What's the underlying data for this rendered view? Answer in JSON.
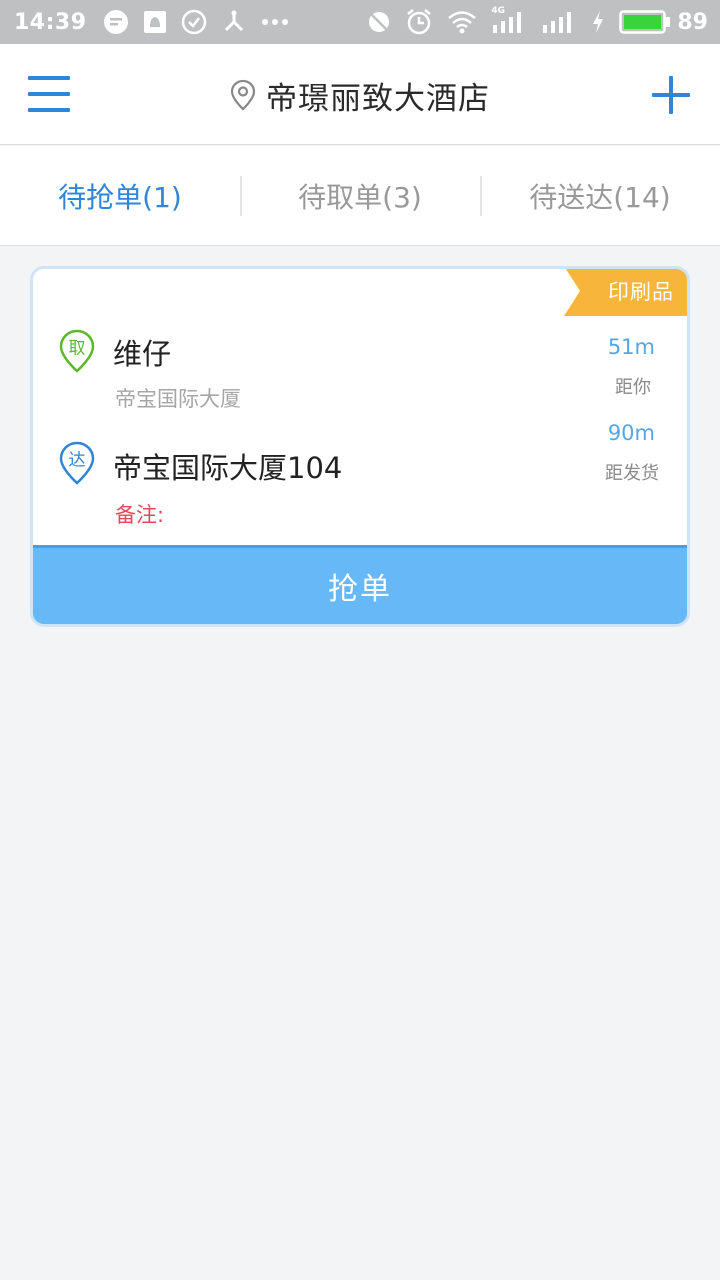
{
  "status_bar": {
    "time": "14:39",
    "battery_level": "89",
    "network_type": "4G",
    "left_icons": [
      "message-icon",
      "notification-icon",
      "check-circle-icon",
      "network-share-icon",
      "more-dots-icon"
    ],
    "right_icons": [
      "mute-icon",
      "alarm-icon",
      "wifi-icon",
      "signal-icon",
      "signal-icon",
      "charging-icon",
      "battery-icon"
    ]
  },
  "header": {
    "title": "帝璟丽致大酒店",
    "menu_icon": "hamburger-menu-icon",
    "location_icon": "location-pin-icon",
    "add_icon": "plus-icon",
    "accent_color": "#2f86d8"
  },
  "tabs": [
    {
      "label": "待抢单(1)",
      "active": true
    },
    {
      "label": "待取单(3)",
      "active": false
    },
    {
      "label": "待送达(14)",
      "active": false
    }
  ],
  "orders": [
    {
      "category": "印刷品",
      "pickup": {
        "badge": "取",
        "name": "维仔",
        "address": "帝宝国际大厦"
      },
      "delivery": {
        "badge": "达",
        "address": "帝宝国际大厦104"
      },
      "remark_label": "备注:",
      "distance_to_me": {
        "value": "51m",
        "caption": "距你"
      },
      "distance_to_sender": {
        "value": "90m",
        "caption": "距发货"
      },
      "action_label": "抢单"
    }
  ],
  "colors": {
    "pickup_green": "#5ab82a",
    "delivery_blue": "#2f86d8",
    "tag_orange": "#f8b53c",
    "button_blue": "#66b8f7",
    "remark_red": "#e04a5a"
  }
}
